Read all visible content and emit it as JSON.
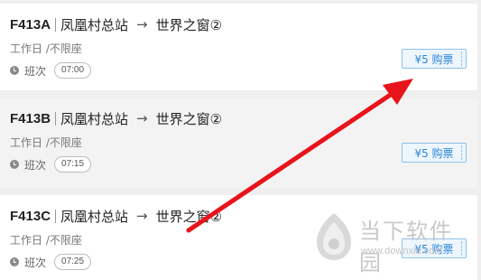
{
  "routes": [
    {
      "code": "F413A",
      "from": "凤凰村总站",
      "arrow": "→",
      "to": "世界之窗②",
      "meta": "工作日 /不限座",
      "shift_label": "班次",
      "time": "07:00",
      "buy_label": "¥5 购票"
    },
    {
      "code": "F413B",
      "from": "凤凰村总站",
      "arrow": "→",
      "to": "世界之窗②",
      "meta": "工作日 /不限座",
      "shift_label": "班次",
      "time": "07:15",
      "buy_label": "¥5 购票"
    },
    {
      "code": "F413C",
      "from": "凤凰村总站",
      "arrow": "→",
      "to": "世界之窗②",
      "meta": "工作日 /不限座",
      "shift_label": "班次",
      "time": "07:25",
      "buy_label": "¥5 购票"
    }
  ],
  "watermark": {
    "name": "当下软件园",
    "url": "www.downxia.com"
  },
  "colors": {
    "accent": "#2a86d8",
    "annotation_arrow": "#e8141b"
  },
  "icons": {
    "time": "clock-icon",
    "watermark": "downxia-logo-icon"
  }
}
